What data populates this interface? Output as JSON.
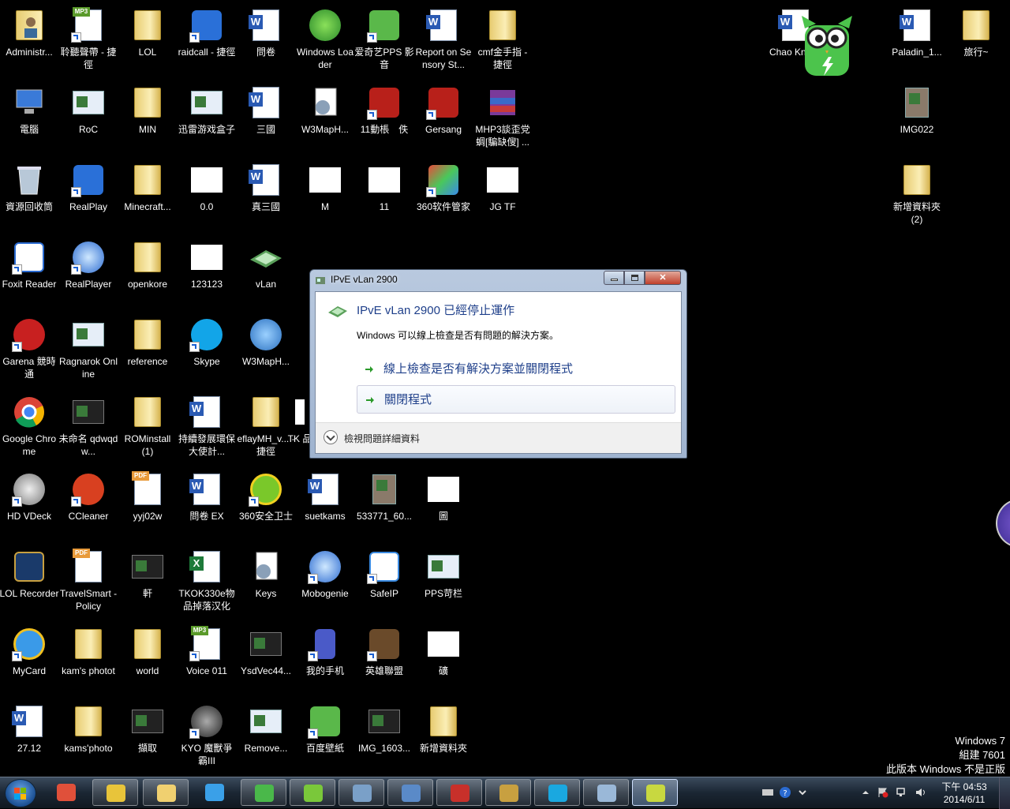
{
  "desktop": {
    "icons": [
      {
        "label": "Administr...",
        "kind": "folder-user"
      },
      {
        "label": "聆聽聲帶 - 捷徑",
        "kind": "mp3"
      },
      {
        "label": "LOL",
        "kind": "folder"
      },
      {
        "label": "raidcall - 捷徑",
        "kind": "app-blue"
      },
      {
        "label": "問卷",
        "kind": "word"
      },
      {
        "label": "Windows Loader",
        "kind": "round-green"
      },
      {
        "label": "爱奇艺PPS 影音",
        "kind": "app-green"
      },
      {
        "label": "Report on Sensory St...",
        "kind": "word"
      },
      {
        "label": "cmf金手指 - 捷徑",
        "kind": "folder"
      },
      {
        "label": "電腦",
        "kind": "computer"
      },
      {
        "label": "RoC",
        "kind": "window"
      },
      {
        "label": "MIN",
        "kind": "folder"
      },
      {
        "label": "迅雷游戏盒子",
        "kind": "window"
      },
      {
        "label": "三國",
        "kind": "word"
      },
      {
        "label": "W3MapH...",
        "kind": "gear"
      },
      {
        "label": "11動棖　佚",
        "kind": "app-red"
      },
      {
        "label": "Gersang",
        "kind": "app-red"
      },
      {
        "label": "MHP3談歪党蜩[騙缺傁] ...",
        "kind": "winrar"
      },
      {
        "label": "資源回收筒",
        "kind": "bin"
      },
      {
        "label": "RealPlay",
        "kind": "app-blue"
      },
      {
        "label": "Minecraft...",
        "kind": "folder"
      },
      {
        "label": "0.0",
        "kind": "blank"
      },
      {
        "label": "真三國",
        "kind": "word"
      },
      {
        "label": "M",
        "kind": "blank"
      },
      {
        "label": "11",
        "kind": "blank"
      },
      {
        "label": "360软件管家",
        "kind": "app-360"
      },
      {
        "label": "JG TF",
        "kind": "blank"
      },
      {
        "label": "Foxit Reader",
        "kind": "app-foxit"
      },
      {
        "label": "RealPlayer",
        "kind": "round-blue"
      },
      {
        "label": "openkore",
        "kind": "folder"
      },
      {
        "label": "123123",
        "kind": "blank"
      },
      {
        "label": "vLan",
        "kind": "vlan"
      },
      {
        "label": "Garena 競時通",
        "kind": "app-garena"
      },
      {
        "label": "Ragnarok Online",
        "kind": "window"
      },
      {
        "label": "reference",
        "kind": "folder"
      },
      {
        "label": "Skype",
        "kind": "skype"
      },
      {
        "label": "W3MapH...",
        "kind": "round-globe"
      },
      {
        "label": "Google Chrome",
        "kind": "chrome"
      },
      {
        "label": "未命名 qdwqdw...",
        "kind": "video"
      },
      {
        "label": "ROMinstall (1)",
        "kind": "folder"
      },
      {
        "label": "持續發展環保大使計...",
        "kind": "word"
      },
      {
        "label": "eflayMH_v... - 捷徑",
        "kind": "folder"
      },
      {
        "label": "HD VDeck",
        "kind": "round-gray"
      },
      {
        "label": "CCleaner",
        "kind": "app-ccleaner"
      },
      {
        "label": "yyj02w",
        "kind": "pdf"
      },
      {
        "label": "問卷 EX",
        "kind": "word"
      },
      {
        "label": "360安全卫士",
        "kind": "app-360safe"
      },
      {
        "label": "suetkams",
        "kind": "word"
      },
      {
        "label": "533771_60...",
        "kind": "photo"
      },
      {
        "label": "圖",
        "kind": "blank"
      },
      {
        "label": "LOL Recorder",
        "kind": "app-lol"
      },
      {
        "label": "TravelSmart - Policy",
        "kind": "pdf"
      },
      {
        "label": "軒",
        "kind": "video"
      },
      {
        "label": "TKOK330e物品掉落汉化",
        "kind": "excel"
      },
      {
        "label": "Keys",
        "kind": "gear"
      },
      {
        "label": "Mobogenie",
        "kind": "round-blue"
      },
      {
        "label": "SafeIP",
        "kind": "app-safeip"
      },
      {
        "label": "PPS苛栏",
        "kind": "window"
      },
      {
        "label": "MyCard",
        "kind": "app-ie"
      },
      {
        "label": "kam's photot",
        "kind": "folder"
      },
      {
        "label": "world",
        "kind": "folder"
      },
      {
        "label": "Voice 011",
        "kind": "mp3"
      },
      {
        "label": "YsdVec44...",
        "kind": "video"
      },
      {
        "label": "我的手机",
        "kind": "app-phone"
      },
      {
        "label": "英雄聯盟",
        "kind": "app-lol2"
      },
      {
        "label": "礦",
        "kind": "blank"
      },
      {
        "label": "27.12",
        "kind": "word"
      },
      {
        "label": "kams'photo",
        "kind": "folder"
      },
      {
        "label": "擷取",
        "kind": "video"
      },
      {
        "label": "KYO 魔獸爭霸III",
        "kind": "round-dark"
      },
      {
        "label": "Remove...",
        "kind": "window"
      },
      {
        "label": "百度壁紙",
        "kind": "app-green"
      },
      {
        "label": "IMG_1603...",
        "kind": "video"
      },
      {
        "label": "新增資料夾",
        "kind": "folder"
      },
      {
        "label": "TK 品",
        "kind": "blank-partial"
      },
      {
        "label": "Chao Knight",
        "kind": "blank-doc"
      },
      {
        "label": "Paladin_1...",
        "kind": "blank-doc"
      },
      {
        "label": "旅行~",
        "kind": "folder"
      },
      {
        "label": "IMG022",
        "kind": "photo"
      },
      {
        "label": "新增資料夾 (2)",
        "kind": "folder"
      }
    ]
  },
  "dialog": {
    "title": "IPvE vLan 2900",
    "close_glyph": "✕",
    "heading": "IPvE vLan 2900 已經停止運作",
    "subtext": "Windows 可以線上檢查是否有問題的解決方案。",
    "option_online_check": "線上檢查是否有解決方案並關閉程式",
    "option_close": "關閉程式",
    "details_label": "檢視問題詳細資料"
  },
  "watermark": {
    "line1": "Windows 7",
    "line2": "組建 7601",
    "line3": "此版本 Windows 不是正版"
  },
  "taskbar": {
    "buttons": [
      {
        "name": "pinwheel-app",
        "color": "#e0503a",
        "open": false
      },
      {
        "name": "chrome",
        "color": "#e8c43a",
        "open": true
      },
      {
        "name": "file-explorer",
        "color": "#f0d070",
        "open": true
      },
      {
        "name": "mobogenie",
        "color": "#3aa0e8",
        "open": false
      },
      {
        "name": "baidu-wallpaper",
        "color": "#4ab84a",
        "open": true
      },
      {
        "name": "iqiyi",
        "color": "#7ac83a",
        "open": true
      },
      {
        "name": "messenger",
        "color": "#7aa0c8",
        "open": true
      },
      {
        "name": "network-app",
        "color": "#5a8ac8",
        "open": true
      },
      {
        "name": "garena",
        "color": "#c8302a",
        "open": true
      },
      {
        "name": "league-of-legends",
        "color": "#c8a040",
        "open": true
      },
      {
        "name": "skype",
        "color": "#1aa8e0",
        "open": true
      },
      {
        "name": "chat-bubbles",
        "color": "#9ab8d8",
        "open": true
      },
      {
        "name": "vlan-app",
        "color": "#c8d840",
        "open": true,
        "active": true
      }
    ],
    "clock_time": "下午 04:53",
    "clock_date": "2014/6/11"
  },
  "colors": {
    "desktop_bg": "#000000",
    "dialog_heading": "#1e3f8a",
    "taskbar_bg": "#1b2633"
  }
}
